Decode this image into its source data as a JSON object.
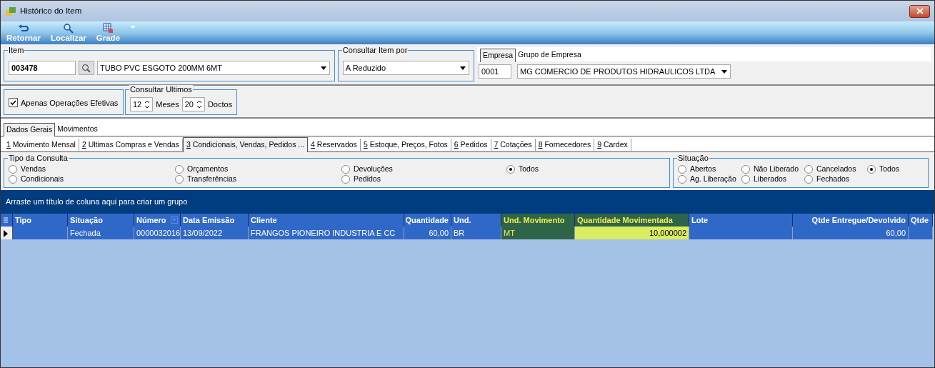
{
  "window": {
    "title": "Histórico do Item"
  },
  "toolbar": [
    {
      "label": "Retornar",
      "dropdown": false
    },
    {
      "label": "Localizar",
      "dropdown": false
    },
    {
      "label": "Grade",
      "dropdown": true
    }
  ],
  "item": {
    "legend": "Item",
    "code": "003478",
    "description": "TUBO PVC ESGOTO 200MM 6MT"
  },
  "consultar_item_por": {
    "legend": "Consultar Item por",
    "value": "A Reduzido"
  },
  "empresa_tabs": [
    {
      "label": "Empresa",
      "selected": true
    },
    {
      "label": "Grupo de Empresa",
      "selected": false
    }
  ],
  "empresa": {
    "code": "0001",
    "name": "MG COMERCIO DE PRODUTOS HIDRAULICOS LTDA"
  },
  "apenas_efetivas": {
    "label": "Apenas Operações Efetivas",
    "checked": true
  },
  "consultar_ultimos": {
    "legend": "Consultar Ultimos",
    "months": "12",
    "months_label": "Meses",
    "docs": "20",
    "docs_label": "Doctos"
  },
  "main_tabs": [
    {
      "label": "Dados Gerais",
      "selected": true
    },
    {
      "label": "Movimentos",
      "selected": false
    }
  ],
  "sub_tabs": [
    {
      "key": "1",
      "label": "Movimento Mensal",
      "selected": false
    },
    {
      "key": "2",
      "label": "Ultimas Compras e Vendas",
      "selected": false
    },
    {
      "key": "3",
      "label": "Condicionais, Vendas, Pedidos ...",
      "selected": true
    },
    {
      "key": "4",
      "label": "Reservados",
      "selected": false
    },
    {
      "key": "5",
      "label": "Estoque, Preços, Fotos",
      "selected": false
    },
    {
      "key": "6",
      "label": "Pedidos",
      "selected": false
    },
    {
      "key": "7",
      "label": "Cotações",
      "selected": false
    },
    {
      "key": "8",
      "label": "Fornecedores",
      "selected": false
    },
    {
      "key": "9",
      "label": "Cardex",
      "selected": false
    }
  ],
  "tipo_da_consulta": {
    "legend": "Tipo da Consulta",
    "options": [
      {
        "label": "Vendas",
        "selected": false
      },
      {
        "label": "Condicionais",
        "selected": false
      },
      {
        "label": "Orçamentos",
        "selected": false
      },
      {
        "label": "Transferências",
        "selected": false
      },
      {
        "label": "Devoluções",
        "selected": false
      },
      {
        "label": "Pedidos",
        "selected": false
      },
      {
        "label": "Todos",
        "selected": true
      }
    ]
  },
  "situacao": {
    "legend": "Situação",
    "options": [
      {
        "label": "Abertos",
        "selected": false
      },
      {
        "label": "Ag. Liberação",
        "selected": false
      },
      {
        "label": "Não Liberado",
        "selected": false
      },
      {
        "label": "Liberados",
        "selected": false
      },
      {
        "label": "Cancelados",
        "selected": false
      },
      {
        "label": "Fechados",
        "selected": false
      },
      {
        "label": "Todos",
        "selected": true
      }
    ]
  },
  "grid": {
    "group_hint": "Arraste um título de coluna aqui para criar um grupo",
    "columns": [
      {
        "label": "Tipo",
        "kind": "text",
        "highlighted": false
      },
      {
        "label": "Situação",
        "kind": "text",
        "highlighted": false
      },
      {
        "label": "Número",
        "kind": "text",
        "highlighted": false,
        "filter": true
      },
      {
        "label": "Data Emissão",
        "kind": "text",
        "highlighted": false
      },
      {
        "label": "Cliente",
        "kind": "text",
        "highlighted": false
      },
      {
        "label": "Quantidade",
        "kind": "number",
        "highlighted": false
      },
      {
        "label": "Und.",
        "kind": "text",
        "highlighted": false
      },
      {
        "label": "Und. Movimento",
        "kind": "text",
        "highlighted": true
      },
      {
        "label": "Quantidade Movimentada",
        "kind": "number",
        "highlighted": true
      },
      {
        "label": "Lote",
        "kind": "text",
        "highlighted": false
      },
      {
        "label": "Qtde Entregue/Devolvido",
        "kind": "number",
        "highlighted": false
      },
      {
        "label": "Qtde",
        "kind": "text",
        "highlighted": false
      }
    ],
    "rows": [
      {
        "selected": true,
        "cells": [
          "",
          "Fechada",
          "0000032016",
          "13/09/2022",
          "FRANGOS PIONEIRO INDUSTRIA E CC",
          "60,00",
          "BR",
          "MT",
          "10,000002",
          "",
          "60,00",
          ""
        ]
      }
    ]
  }
}
